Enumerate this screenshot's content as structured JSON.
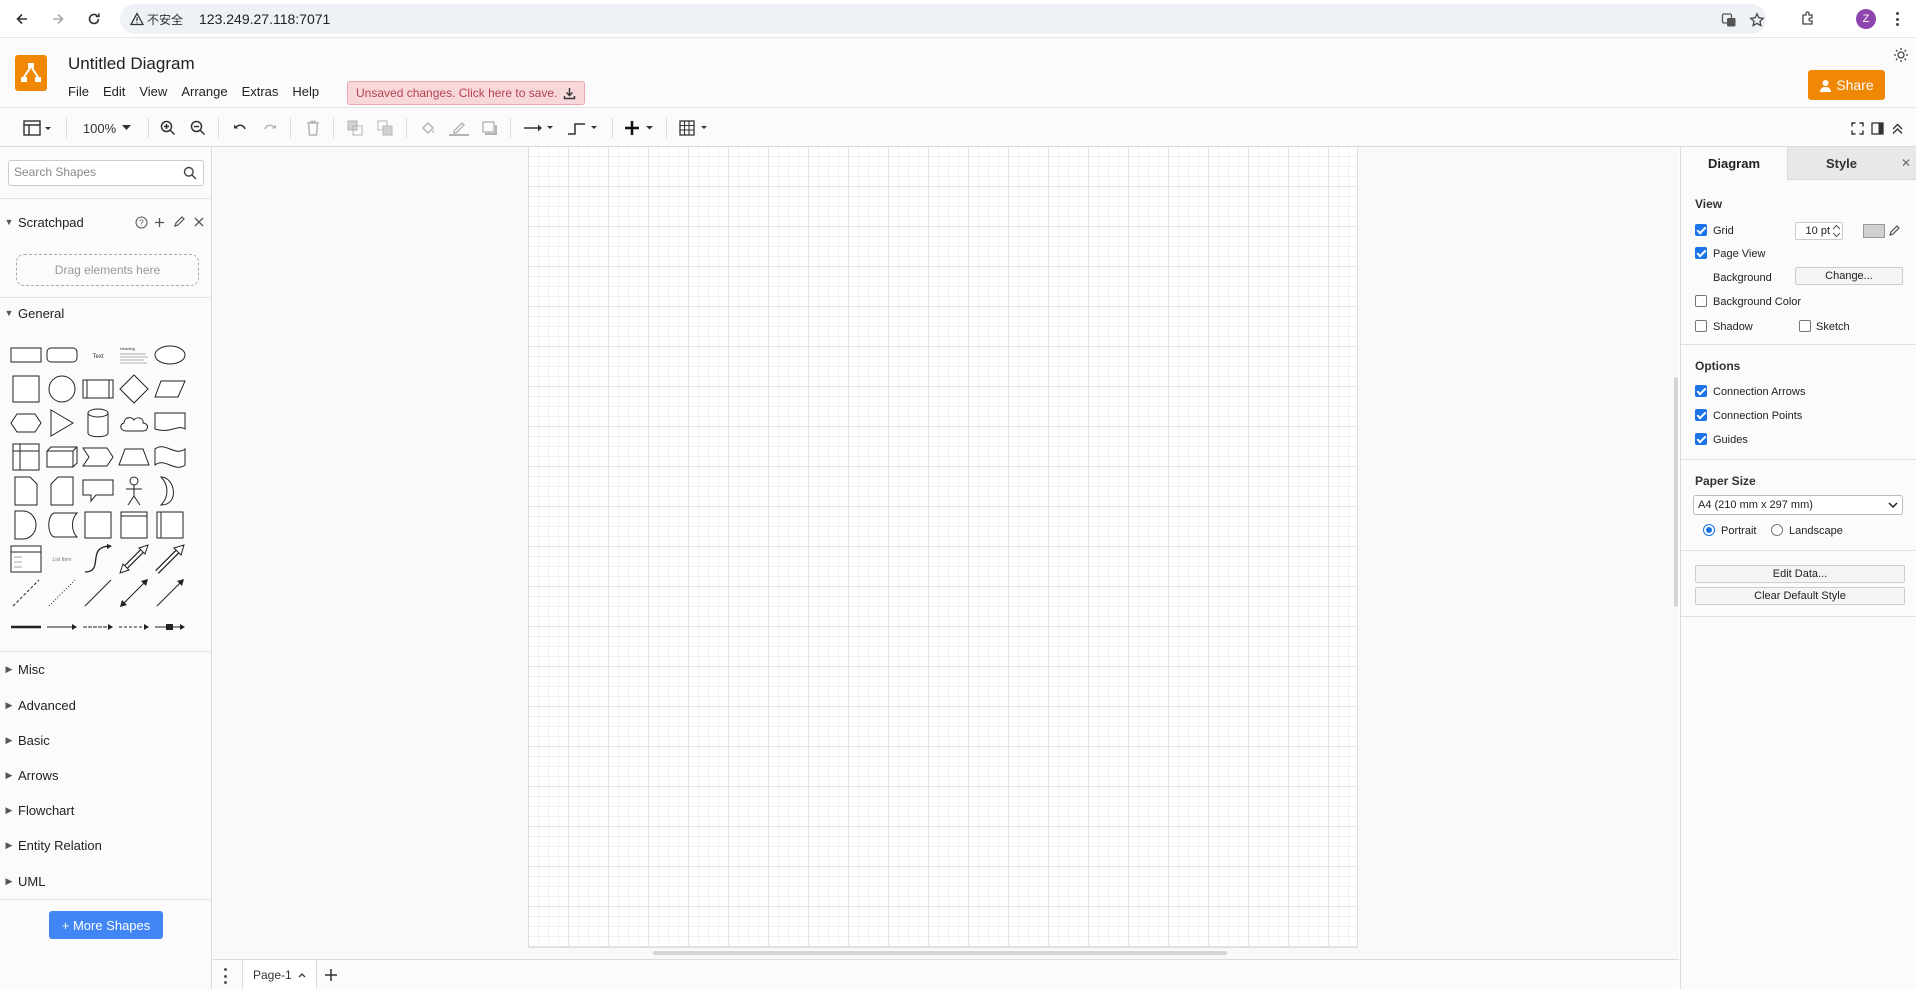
{
  "browser": {
    "security_label": "不安全",
    "url": "123.249.27.118:7071",
    "profile_initial": "Z"
  },
  "app": {
    "title": "Untitled Diagram",
    "menus": [
      "File",
      "Edit",
      "View",
      "Arrange",
      "Extras",
      "Help"
    ],
    "unsaved_banner": "Unsaved changes. Click here to save.",
    "share_label": "Share",
    "accent_color": "#f08705"
  },
  "toolbar": {
    "zoom": "100%"
  },
  "sidebar": {
    "search_placeholder": "Search Shapes",
    "scratchpad_title": "Scratchpad",
    "scratchpad_drop": "Drag elements here",
    "general_title": "General",
    "collapsed_sections": [
      "Misc",
      "Advanced",
      "Basic",
      "Arrows",
      "Flowchart",
      "Entity Relation",
      "UML"
    ],
    "more_shapes_label": "+ More Shapes"
  },
  "pages": {
    "current": "Page-1"
  },
  "format_panel": {
    "tabs": [
      "Diagram",
      "Style"
    ],
    "view_heading": "View",
    "grid_label": "Grid",
    "grid_checked": true,
    "grid_size": "10 pt",
    "page_view_label": "Page View",
    "page_view_checked": true,
    "background_label": "Background",
    "change_button": "Change...",
    "background_color_label": "Background Color",
    "background_color_checked": false,
    "shadow_label": "Shadow",
    "shadow_checked": false,
    "sketch_label": "Sketch",
    "sketch_checked": false,
    "options_heading": "Options",
    "connection_arrows_label": "Connection Arrows",
    "connection_arrows_checked": true,
    "connection_points_label": "Connection Points",
    "connection_points_checked": true,
    "guides_label": "Guides",
    "guides_checked": true,
    "paper_size_heading": "Paper Size",
    "paper_size_value": "A4 (210 mm x 297 mm)",
    "portrait_label": "Portrait",
    "landscape_label": "Landscape",
    "orientation": "Portrait",
    "edit_data_button": "Edit Data...",
    "clear_style_button": "Clear Default Style"
  }
}
